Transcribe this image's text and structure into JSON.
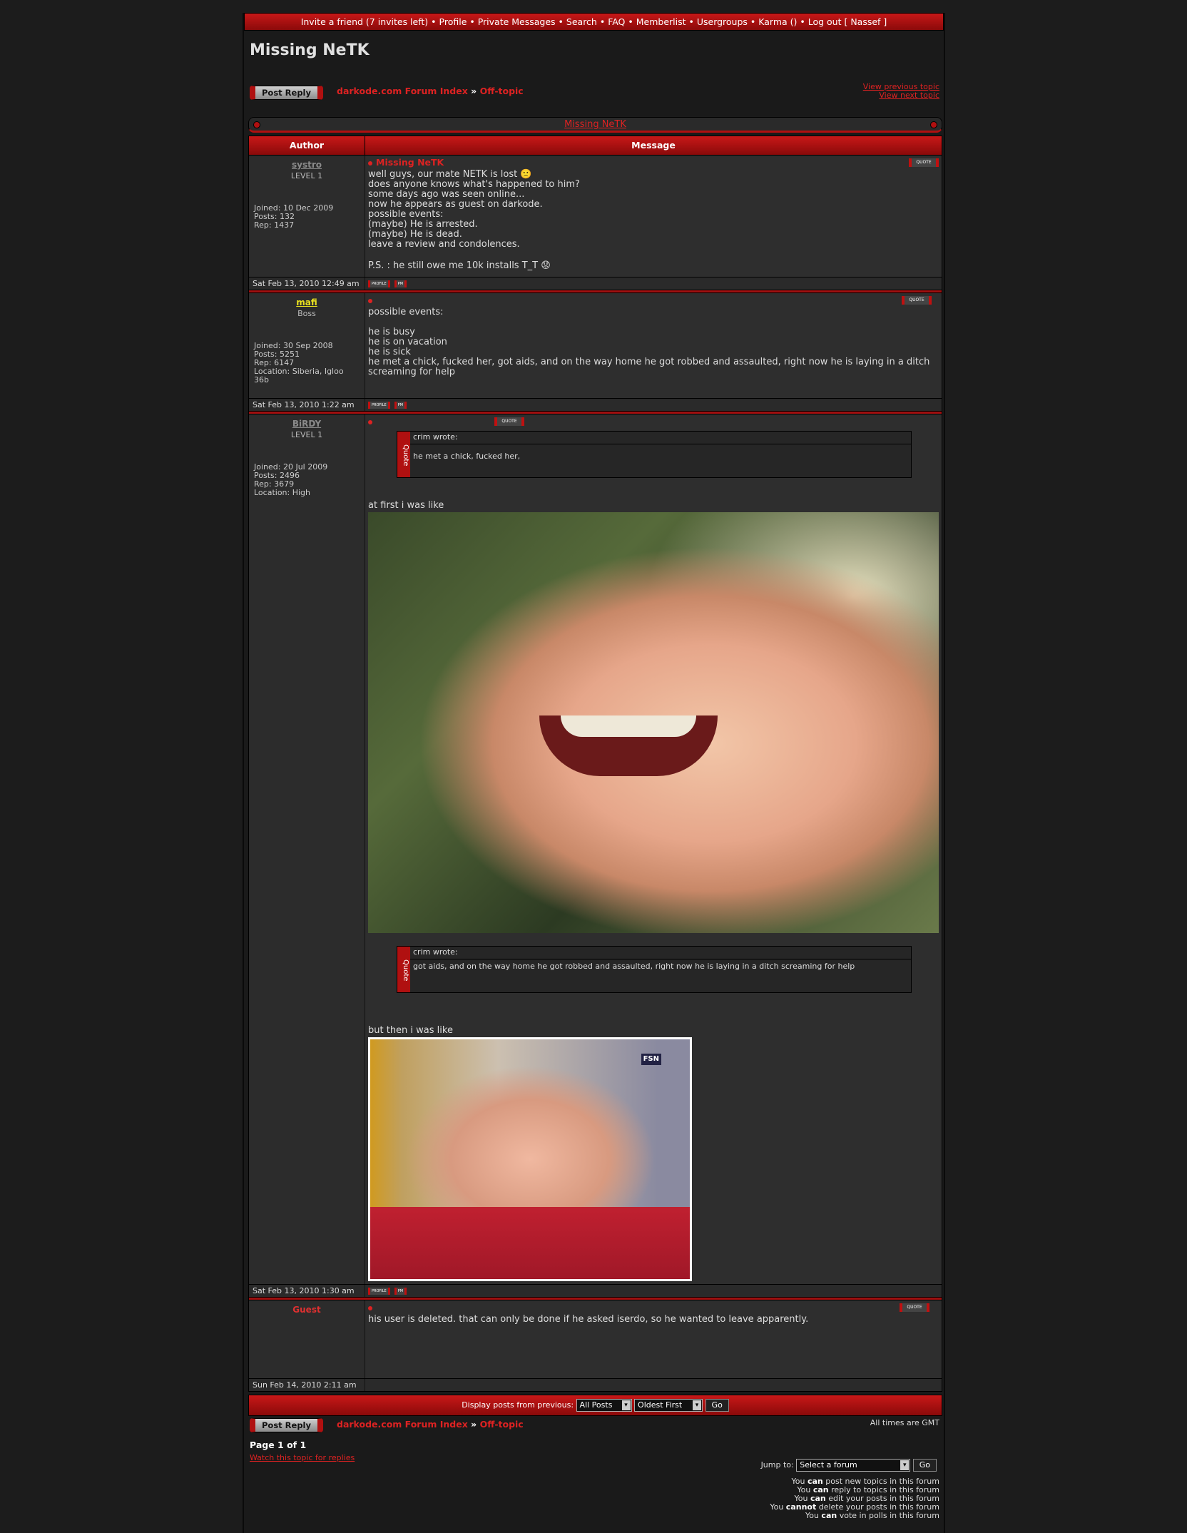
{
  "topnav": {
    "items": [
      "Invite a friend (7 invites left)",
      "Profile",
      "Private Messages",
      "Search",
      "FAQ",
      "Memberlist",
      "Usergroups",
      "Karma ()",
      "Log out [ Nassef ]"
    ]
  },
  "page": {
    "title": "Missing NeTK"
  },
  "actions": {
    "post_reply": "Post Reply"
  },
  "breadcrumb": {
    "forum_index": "darkode.com Forum Index",
    "separator": "»",
    "subforum": "Off-topic"
  },
  "topic_nav": {
    "previous": "View previous topic",
    "next": "View next topic"
  },
  "topic_bar": {
    "title": "Missing NeTK"
  },
  "table_headers": {
    "author": "Author",
    "message": "Message"
  },
  "buttons": {
    "quote": "QUOTE",
    "profile": "PROFILE",
    "pm": "PM"
  },
  "posts": [
    {
      "username": "systro",
      "username_color": "#8a8a8a",
      "rank": "LEVEL 1",
      "info": [
        "Joined: 10 Dec 2009",
        "Posts: 132",
        "Rep: 1437"
      ],
      "title": "Missing NeTK",
      "lines": [
        "well guys, our mate NETK is lost 🙁",
        "does anyone knows what's happened to him?",
        "some days ago was seen online...",
        "now he appears as guest on darkode.",
        "possible events:",
        "(maybe) He is arrested.",
        "(maybe) He is dead.",
        "leave a review and condolences.",
        "",
        "P.S. : he still owe me 10k installs T_T 😟"
      ],
      "date": "Sat Feb 13, 2010 12:49 am"
    },
    {
      "username": "mafi",
      "username_color": "#e8e020",
      "rank": "Boss",
      "info": [
        "Joined: 30 Sep 2008",
        "Posts: 5251",
        "Rep: 6147",
        "Location: Siberia, Igloo 36b"
      ],
      "title": "",
      "lines": [
        "possible events:",
        "",
        "he is busy",
        "he is on vacation",
        "he is sick",
        "he met a chick, fucked her, got aids, and on the way home he got robbed and assaulted, right now he is laying in a ditch screaming for help"
      ],
      "date": "Sat Feb 13, 2010 1:22 am"
    },
    {
      "username": "BiRDY",
      "username_color": "#8a8a8a",
      "rank": "LEVEL 1",
      "info": [
        "Joined: 20 Jul 2009",
        "Posts: 2496",
        "Rep: 3679",
        "Location: High"
      ],
      "quote1_author": "crim wrote:",
      "quote1_text": "he met a chick, fucked her,",
      "text_after_quote1": "at first i was like",
      "quote2_author": "crim wrote:",
      "quote2_text": "got aids, and on the way home he got robbed and assaulted, right now he is laying in a ditch screaming for help",
      "text_after_quote2": "but then i was like",
      "quote_side_label": "Quote",
      "image2_badge": "FSN",
      "date": "Sat Feb 13, 2010 1:30 am"
    },
    {
      "username": "Guest",
      "username_color": "#e03030",
      "lines": [
        "his user is deleted. that can only be done if he asked iserdo, so he wanted to leave apparently."
      ],
      "date": "Sun Feb 14, 2010 2:11 am"
    }
  ],
  "display_bar": {
    "label": "Display posts from previous:",
    "filter_value": "All Posts",
    "order_value": "Oldest First",
    "go": "Go"
  },
  "footer": {
    "timezone": "All times are GMT",
    "pagination": "Page 1 of 1",
    "watch": "Watch this topic for replies",
    "jump_label": "Jump to:",
    "jump_value": "Select a forum",
    "jump_go": "Go",
    "permissions": [
      {
        "pre": "You ",
        "bold": "can",
        "post": " post new topics in this forum"
      },
      {
        "pre": "You ",
        "bold": "can",
        "post": " reply to topics in this forum"
      },
      {
        "pre": "You ",
        "bold": "can",
        "post": " edit your posts in this forum"
      },
      {
        "pre": "You ",
        "bold": "cannot",
        "post": " delete your posts in this forum"
      },
      {
        "pre": "You ",
        "bold": "can",
        "post": " vote in polls in this forum"
      }
    ]
  }
}
